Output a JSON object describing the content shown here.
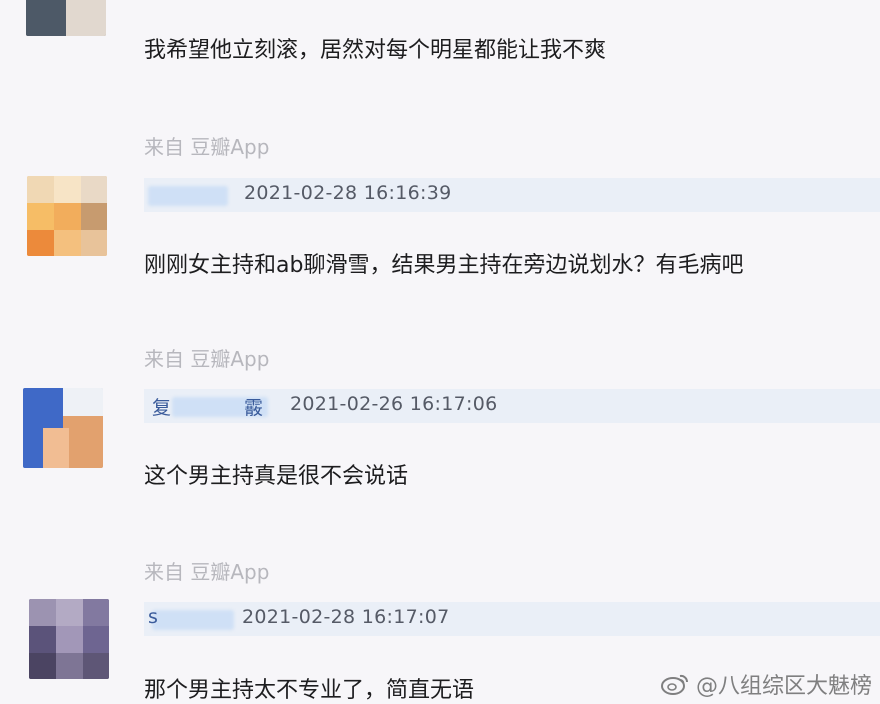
{
  "comments": [
    {
      "text": "我希望他立刻滚，居然对每个明星都能让我不爽"
    },
    {
      "source": "来自 豆瓣App",
      "username": "",
      "time": "2021-02-28 16:16:39",
      "text": "刚刚女主持和ab聊滑雪，结果男主持在旁边说划水？有毛病吧"
    },
    {
      "source": "来自 豆瓣App",
      "username": "复",
      "username_tail": "霰",
      "time": "2021-02-26 16:17:06",
      "text": "这个男主持真是很不会说话"
    },
    {
      "source": "来自 豆瓣App",
      "username": "s",
      "time": "2021-02-28 16:17:07",
      "text": "那个男主持太不专业了，简直无语"
    }
  ],
  "watermark": {
    "icon": "weibo-icon",
    "text": "@八组综区大魅榜"
  }
}
